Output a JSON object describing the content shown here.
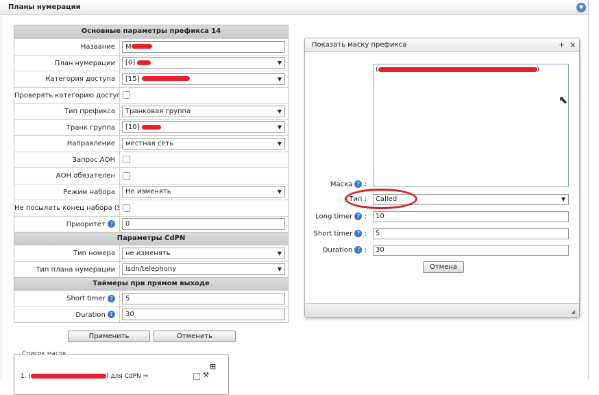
{
  "panel": {
    "title": "Планы нумерации",
    "collapse_icon": "chevron-down-icon"
  },
  "form": {
    "section1": "Основные параметры префикса 14",
    "rows": [
      {
        "label": "Название",
        "value": "M"
      },
      {
        "label": "План нумерации",
        "value": "[0]"
      },
      {
        "label": "Категория доступа",
        "value": "[15]"
      },
      {
        "label": "Проверять категорию доступа"
      },
      {
        "label": "Тип префикса",
        "value": "Транковая группа"
      },
      {
        "label": "Транк группа",
        "value": "[10]"
      },
      {
        "label": "Направление",
        "value": "местная сеть"
      },
      {
        "label": "Запрос АОН"
      },
      {
        "label": "АОН обязателен"
      },
      {
        "label": "Режим набора",
        "value": "Не изменять"
      },
      {
        "label": "Не посылать конец набора (ST)"
      },
      {
        "label": "Приоритет",
        "value": "0"
      }
    ],
    "section2": "Параметры CdPN",
    "rows2": [
      {
        "label": "Тип номера",
        "value": "не изменять"
      },
      {
        "label": "Тип плана нумерации",
        "value": "isdn/telephony"
      }
    ],
    "section3": "Таймеры при прямом выходе",
    "rows3": [
      {
        "label": "Short timer",
        "value": "5"
      },
      {
        "label": "Duration",
        "value": "30"
      }
    ],
    "apply_label": "Применить",
    "cancel_label": "Отменить"
  },
  "masks": {
    "legend": "Список масок",
    "item_prefix": "1. (",
    "item_suffix": ") для CdPN ⇒"
  },
  "dialog": {
    "title": "Показать маску префикса",
    "plus": "+",
    "close": "×",
    "mask_text": "(",
    "mask_end": ")",
    "mask_label": "Маска",
    "type_label": "Тип",
    "type_value": "Called",
    "long_timer_label": "Long timer",
    "long_timer_value": "10",
    "short_timer_label": "Short timer",
    "short_timer_value": "5",
    "duration_label": "Duration",
    "duration_value": "30",
    "cancel_label": "Отмена"
  }
}
